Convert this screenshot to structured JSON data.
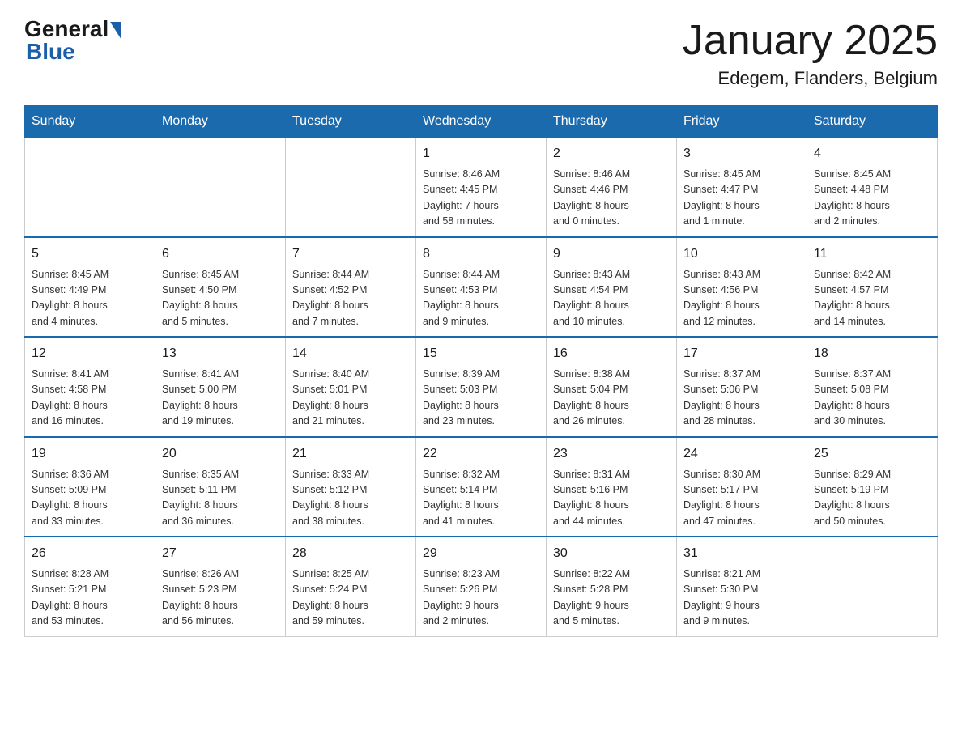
{
  "header": {
    "logo": {
      "general": "General",
      "blue": "Blue"
    },
    "title": "January 2025",
    "location": "Edegem, Flanders, Belgium"
  },
  "days_of_week": [
    "Sunday",
    "Monday",
    "Tuesday",
    "Wednesday",
    "Thursday",
    "Friday",
    "Saturday"
  ],
  "weeks": [
    {
      "days": [
        {
          "num": "",
          "info": ""
        },
        {
          "num": "",
          "info": ""
        },
        {
          "num": "",
          "info": ""
        },
        {
          "num": "1",
          "info": "Sunrise: 8:46 AM\nSunset: 4:45 PM\nDaylight: 7 hours\nand 58 minutes."
        },
        {
          "num": "2",
          "info": "Sunrise: 8:46 AM\nSunset: 4:46 PM\nDaylight: 8 hours\nand 0 minutes."
        },
        {
          "num": "3",
          "info": "Sunrise: 8:45 AM\nSunset: 4:47 PM\nDaylight: 8 hours\nand 1 minute."
        },
        {
          "num": "4",
          "info": "Sunrise: 8:45 AM\nSunset: 4:48 PM\nDaylight: 8 hours\nand 2 minutes."
        }
      ]
    },
    {
      "days": [
        {
          "num": "5",
          "info": "Sunrise: 8:45 AM\nSunset: 4:49 PM\nDaylight: 8 hours\nand 4 minutes."
        },
        {
          "num": "6",
          "info": "Sunrise: 8:45 AM\nSunset: 4:50 PM\nDaylight: 8 hours\nand 5 minutes."
        },
        {
          "num": "7",
          "info": "Sunrise: 8:44 AM\nSunset: 4:52 PM\nDaylight: 8 hours\nand 7 minutes."
        },
        {
          "num": "8",
          "info": "Sunrise: 8:44 AM\nSunset: 4:53 PM\nDaylight: 8 hours\nand 9 minutes."
        },
        {
          "num": "9",
          "info": "Sunrise: 8:43 AM\nSunset: 4:54 PM\nDaylight: 8 hours\nand 10 minutes."
        },
        {
          "num": "10",
          "info": "Sunrise: 8:43 AM\nSunset: 4:56 PM\nDaylight: 8 hours\nand 12 minutes."
        },
        {
          "num": "11",
          "info": "Sunrise: 8:42 AM\nSunset: 4:57 PM\nDaylight: 8 hours\nand 14 minutes."
        }
      ]
    },
    {
      "days": [
        {
          "num": "12",
          "info": "Sunrise: 8:41 AM\nSunset: 4:58 PM\nDaylight: 8 hours\nand 16 minutes."
        },
        {
          "num": "13",
          "info": "Sunrise: 8:41 AM\nSunset: 5:00 PM\nDaylight: 8 hours\nand 19 minutes."
        },
        {
          "num": "14",
          "info": "Sunrise: 8:40 AM\nSunset: 5:01 PM\nDaylight: 8 hours\nand 21 minutes."
        },
        {
          "num": "15",
          "info": "Sunrise: 8:39 AM\nSunset: 5:03 PM\nDaylight: 8 hours\nand 23 minutes."
        },
        {
          "num": "16",
          "info": "Sunrise: 8:38 AM\nSunset: 5:04 PM\nDaylight: 8 hours\nand 26 minutes."
        },
        {
          "num": "17",
          "info": "Sunrise: 8:37 AM\nSunset: 5:06 PM\nDaylight: 8 hours\nand 28 minutes."
        },
        {
          "num": "18",
          "info": "Sunrise: 8:37 AM\nSunset: 5:08 PM\nDaylight: 8 hours\nand 30 minutes."
        }
      ]
    },
    {
      "days": [
        {
          "num": "19",
          "info": "Sunrise: 8:36 AM\nSunset: 5:09 PM\nDaylight: 8 hours\nand 33 minutes."
        },
        {
          "num": "20",
          "info": "Sunrise: 8:35 AM\nSunset: 5:11 PM\nDaylight: 8 hours\nand 36 minutes."
        },
        {
          "num": "21",
          "info": "Sunrise: 8:33 AM\nSunset: 5:12 PM\nDaylight: 8 hours\nand 38 minutes."
        },
        {
          "num": "22",
          "info": "Sunrise: 8:32 AM\nSunset: 5:14 PM\nDaylight: 8 hours\nand 41 minutes."
        },
        {
          "num": "23",
          "info": "Sunrise: 8:31 AM\nSunset: 5:16 PM\nDaylight: 8 hours\nand 44 minutes."
        },
        {
          "num": "24",
          "info": "Sunrise: 8:30 AM\nSunset: 5:17 PM\nDaylight: 8 hours\nand 47 minutes."
        },
        {
          "num": "25",
          "info": "Sunrise: 8:29 AM\nSunset: 5:19 PM\nDaylight: 8 hours\nand 50 minutes."
        }
      ]
    },
    {
      "days": [
        {
          "num": "26",
          "info": "Sunrise: 8:28 AM\nSunset: 5:21 PM\nDaylight: 8 hours\nand 53 minutes."
        },
        {
          "num": "27",
          "info": "Sunrise: 8:26 AM\nSunset: 5:23 PM\nDaylight: 8 hours\nand 56 minutes."
        },
        {
          "num": "28",
          "info": "Sunrise: 8:25 AM\nSunset: 5:24 PM\nDaylight: 8 hours\nand 59 minutes."
        },
        {
          "num": "29",
          "info": "Sunrise: 8:23 AM\nSunset: 5:26 PM\nDaylight: 9 hours\nand 2 minutes."
        },
        {
          "num": "30",
          "info": "Sunrise: 8:22 AM\nSunset: 5:28 PM\nDaylight: 9 hours\nand 5 minutes."
        },
        {
          "num": "31",
          "info": "Sunrise: 8:21 AM\nSunset: 5:30 PM\nDaylight: 9 hours\nand 9 minutes."
        },
        {
          "num": "",
          "info": ""
        }
      ]
    }
  ]
}
